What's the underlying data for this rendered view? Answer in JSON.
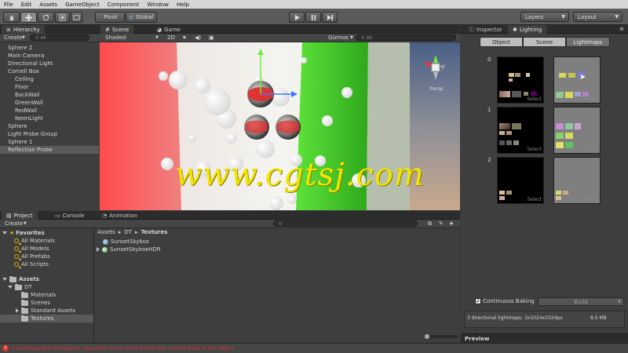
{
  "menu": [
    "File",
    "Edit",
    "Assets",
    "GameObject",
    "Component",
    "Window",
    "Help"
  ],
  "toolbar": {
    "pivot": "Pivot",
    "global": "Global",
    "layers": "Layers",
    "layout": "Layout"
  },
  "hierarchy": {
    "tab": "Hierarchy",
    "create": "Create",
    "search_placeholder": "All",
    "items": [
      {
        "label": "Sphere 2",
        "child": false,
        "selected": false
      },
      {
        "label": "Main Camera",
        "child": false,
        "selected": false
      },
      {
        "label": "Directional Light",
        "child": false,
        "selected": false
      },
      {
        "label": "Cornell Box",
        "child": false,
        "selected": false
      },
      {
        "label": "Ceiling",
        "child": true,
        "selected": false
      },
      {
        "label": "Floor",
        "child": true,
        "selected": false
      },
      {
        "label": "BackWall",
        "child": true,
        "selected": false
      },
      {
        "label": "GreenWall",
        "child": true,
        "selected": false
      },
      {
        "label": "RedWall",
        "child": true,
        "selected": false
      },
      {
        "label": "NeonLight",
        "child": true,
        "selected": false
      },
      {
        "label": "Sphere",
        "child": false,
        "selected": false
      },
      {
        "label": "Light Probe Group",
        "child": false,
        "selected": false
      },
      {
        "label": "Sphere 1",
        "child": false,
        "selected": false
      },
      {
        "label": "Reflection Probe",
        "child": false,
        "selected": true
      }
    ]
  },
  "scene": {
    "tab_scene": "Scene",
    "tab_game": "Game",
    "shading": "Shaded",
    "mode_2d": "2D",
    "gizmos": "Gizmos",
    "search_placeholder": "All",
    "persp": "Persp",
    "watermark": "www.cgtsj.com"
  },
  "inspector": {
    "tab_inspector": "Inspector",
    "tab_lighting": "Lighting",
    "modes": [
      "Object",
      "Scene",
      "Lightmaps"
    ],
    "active_mode": "Lightmaps",
    "row_labels": [
      "0",
      "1",
      "2"
    ],
    "cell_label": "Select",
    "continuous_baking": "Continuous Baking",
    "continuous_checked": true,
    "build": "Build",
    "stats": "3 directional lightmaps: 3x1024x1024px",
    "stats_size": "8.0 MB",
    "preview": "Preview"
  },
  "project": {
    "tab_project": "Project",
    "tab_console": "Console",
    "tab_animation": "Animation",
    "create": "Create",
    "favorites_title": "Favorites",
    "favorites": [
      "All Materials",
      "All Models",
      "All Prefabs",
      "All Scripts"
    ],
    "assets_title": "Assets",
    "tree": {
      "dt": "DT",
      "children": [
        "Materials",
        "Scenes",
        "Standard Assets",
        "Textures"
      ]
    },
    "breadcrumb": [
      "Assets",
      "DT",
      "Textures"
    ],
    "files": [
      "SunsetSkybox",
      "SunsetSkyboxHDR"
    ]
  },
  "status": {
    "error": "InvalidOperationException: Operation is not valid due to the current state of the object"
  },
  "colors": {
    "selection": "#5a5a5a",
    "error": "#e0302a",
    "watermark": "#f2e600"
  }
}
